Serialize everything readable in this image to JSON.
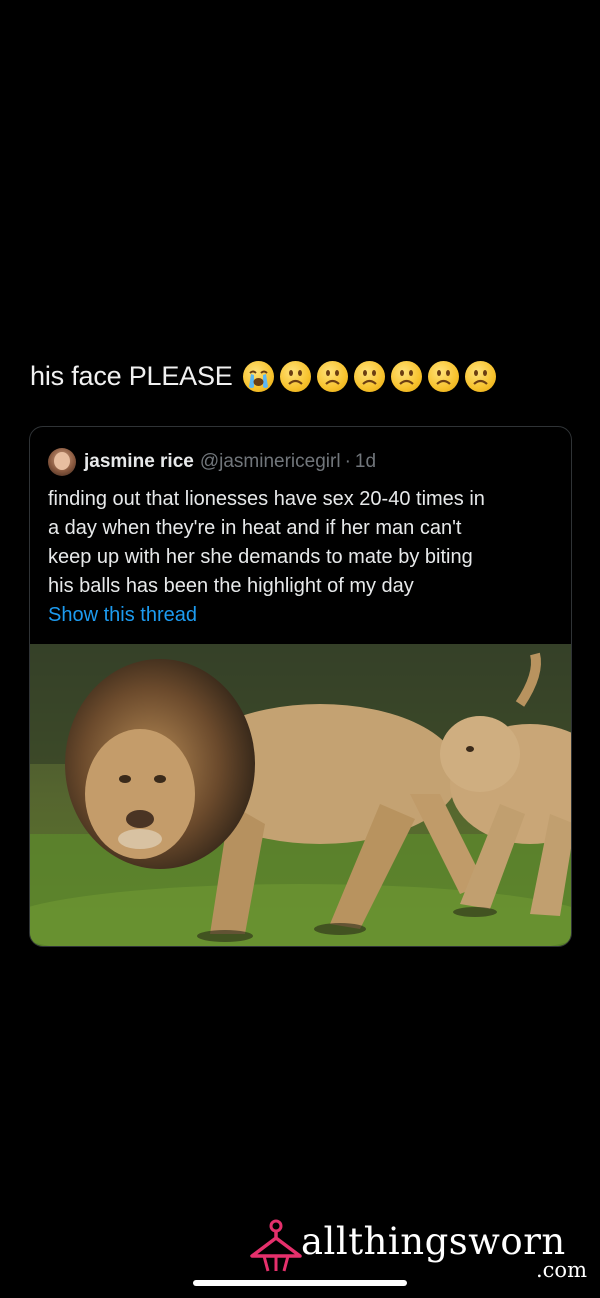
{
  "caption": {
    "text": "his face PLEASE",
    "emojis": [
      "loudly-crying-face-icon",
      "frowning-face-icon",
      "frowning-face-icon",
      "frowning-face-icon",
      "frowning-face-icon",
      "frowning-face-icon",
      "frowning-face-icon"
    ]
  },
  "quoted_tweet": {
    "author_name": "jasmine rice",
    "author_handle": "@jasminericegirl",
    "separator": "·",
    "age": "1d",
    "body_lines": [
      "finding out that lionesses have sex 20-40 times in",
      "a day when they're in heat and if her man can't",
      "keep up with her she demands to mate by biting",
      "his balls has been the highlight of my day"
    ],
    "show_thread_label": "Show this thread",
    "link_color": "#1d9bf0",
    "photo_icon": "lion-and-lioness-photo"
  },
  "watermark": {
    "word": "allthingsworn",
    "domain": ".com",
    "icon": "hanger-icon",
    "accent_color": "#e5306c"
  }
}
